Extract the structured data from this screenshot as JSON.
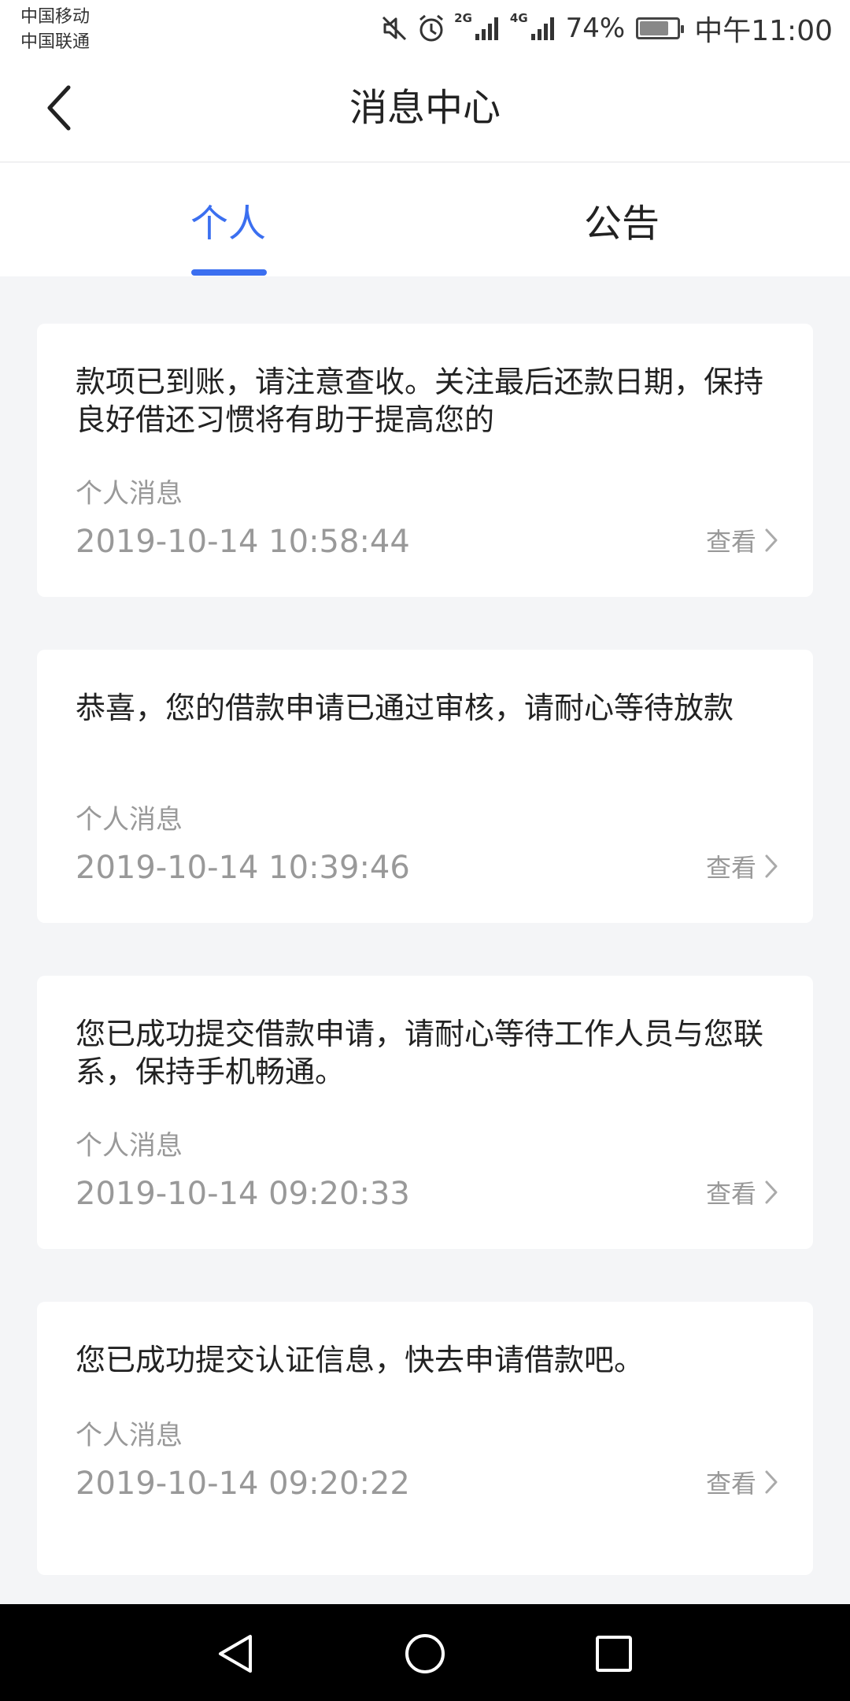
{
  "status_bar": {
    "carrier_1": "中国移动",
    "carrier_2": "中国联通",
    "net_2g": "2G",
    "net_4g": "4G",
    "battery": "74%",
    "time": "中午11:00",
    "icons": [
      "mute-icon",
      "alarm-icon",
      "signal-icon",
      "signal-icon",
      "battery-icon"
    ]
  },
  "header": {
    "title": "消息中心",
    "back_icon": "chevron-left-icon"
  },
  "tabs": [
    {
      "label": "个人",
      "active": true
    },
    {
      "label": "公告",
      "active": false
    }
  ],
  "colors": {
    "accent": "#3b6ff0",
    "background": "#f4f5f7",
    "card": "#ffffff",
    "muted_text": "#999999"
  },
  "messages": [
    {
      "text": "款项已到账，请注意查收。关注最后还款日期，保持良好借还习惯将有助于提高您的",
      "type": "个人消息",
      "time": "2019-10-14 10:58:44",
      "action": "查看"
    },
    {
      "text": "恭喜，您的借款申请已通过审核，请耐心等待放款",
      "type": "个人消息",
      "time": "2019-10-14 10:39:46",
      "action": "查看"
    },
    {
      "text": "您已成功提交借款申请，请耐心等待工作人员与您联系，保持手机畅通。",
      "type": "个人消息",
      "time": "2019-10-14 09:20:33",
      "action": "查看"
    },
    {
      "text": "您已成功提交认证信息，快去申请借款吧。",
      "type": "个人消息",
      "time": "2019-10-14 09:20:22",
      "action": "查看"
    }
  ],
  "nav_bar": {
    "icons": [
      "back-triangle-icon",
      "home-circle-icon",
      "recents-square-icon"
    ]
  }
}
